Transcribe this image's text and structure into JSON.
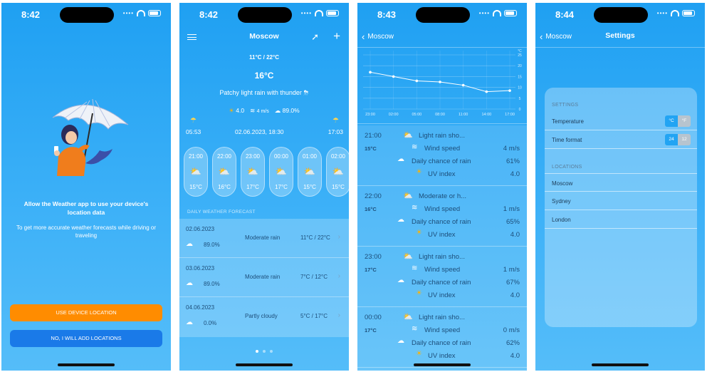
{
  "status": {
    "times": [
      "8:42",
      "8:42",
      "8:43",
      "8:44"
    ]
  },
  "colors": {
    "sky": "#2aa8f4",
    "orange": "#ff8c00",
    "blue_btn": "#1a7ae8",
    "row_text": "#1d4e7a"
  },
  "icons": {
    "menu": "hamburger-icon",
    "locate": "location-arrow-icon",
    "add": "plus-icon",
    "back": "chevron-left-icon"
  },
  "screen1": {
    "title": "Allow the Weather app to use your device's location data",
    "subtitle": "To get more accurate weather forecasts while driving or traveling",
    "btn_location": "USE DEVICE LOCATION",
    "btn_add": "NO, I WILL ADD LOCATIONS"
  },
  "screen2": {
    "city": "Moscow",
    "minmax": "11°C / 22°C",
    "temp": "16°C",
    "condition": "Patchy light rain with thunder",
    "uv": "4.0",
    "wind": "4 m/s",
    "rain": "89.0%",
    "sunrise": "05:53",
    "datetime": "02.06.2023, 18:30",
    "sunset": "17:03",
    "hourly": [
      {
        "time": "21:00",
        "temp": "15°C"
      },
      {
        "time": "22:00",
        "temp": "16°C"
      },
      {
        "time": "23:00",
        "temp": "17°C"
      },
      {
        "time": "00:00",
        "temp": "17°C"
      },
      {
        "time": "01:00",
        "temp": "15°C"
      },
      {
        "time": "02:00",
        "temp": "15°C"
      }
    ],
    "daily_label": "DAILY WEATHER FORECAST",
    "daily": [
      {
        "date": "02.06.2023",
        "pop": "89.0%",
        "cond": "Moderate rain",
        "temps": "11°C / 22°C"
      },
      {
        "date": "03.06.2023",
        "pop": "89.0%",
        "cond": "Moderate rain",
        "temps": "7°C / 12°C"
      },
      {
        "date": "04.06.2023",
        "pop": "0.0%",
        "cond": "Partly cloudy",
        "temps": "5°C / 17°C"
      }
    ],
    "page_count": 3,
    "page_active": 0
  },
  "screen3": {
    "back": "Moscow",
    "chart_data": {
      "type": "line",
      "x": [
        "23:00",
        "02:00",
        "05:00",
        "08:00",
        "11:00",
        "14:00",
        "17:00"
      ],
      "values": [
        17,
        15,
        13,
        12.5,
        11,
        8,
        8.5
      ],
      "ylim": [
        0,
        25
      ],
      "yunit": "°C",
      "yticks": [
        "25",
        "20",
        "15",
        "10",
        "5",
        "0"
      ]
    },
    "rows": [
      {
        "time": "21:00",
        "temp": "15°C",
        "cond": "Light rain sho...",
        "wind": "4 m/s",
        "rain": "61%",
        "uv": "4.0"
      },
      {
        "time": "22:00",
        "temp": "16°C",
        "cond": "Moderate or h...",
        "wind": "1 m/s",
        "rain": "65%",
        "uv": "4.0"
      },
      {
        "time": "23:00",
        "temp": "17°C",
        "cond": "Light rain sho...",
        "wind": "1 m/s",
        "rain": "67%",
        "uv": "4.0"
      },
      {
        "time": "00:00",
        "temp": "17°C",
        "cond": "Light rain sho...",
        "wind": "0 m/s",
        "rain": "62%",
        "uv": "4.0"
      }
    ],
    "labels": {
      "wind": "Wind speed",
      "rain": "Daily chance of rain",
      "uv": "UV index"
    }
  },
  "screen4": {
    "back": "Moscow",
    "title": "Settings",
    "settings_header": "SETTINGS",
    "temperature_label": "Temperature",
    "temp_opts": [
      "°C",
      "°F"
    ],
    "timeformat_label": "Time format",
    "time_opts": [
      "24",
      "12"
    ],
    "locations_header": "LOCATIONS",
    "locations": [
      "Moscow",
      "Sydney",
      "London"
    ]
  }
}
